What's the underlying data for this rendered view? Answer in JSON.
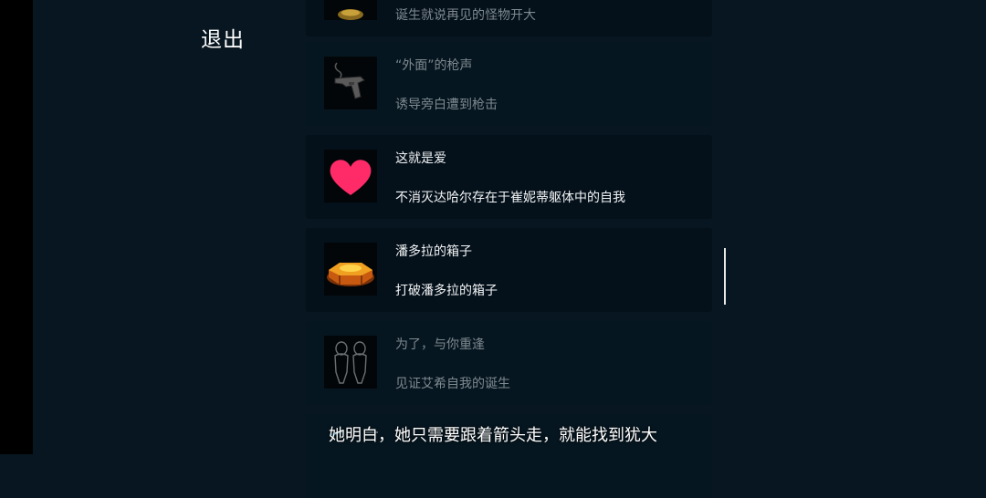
{
  "header": {
    "exit_label": "退出"
  },
  "achievements": [
    {
      "title": "",
      "description": "诞生就说再见的怪物开大",
      "icon": "gold-item-icon",
      "unlocked": false
    },
    {
      "title": "“外面”的枪声",
      "description": "诱导旁白遭到枪击",
      "icon": "pistol-icon",
      "unlocked": false
    },
    {
      "title": "这就是爱",
      "description": "不消灭达哈尔存在于崔妮蒂躯体中的自我",
      "icon": "heart-icon",
      "unlocked": true
    },
    {
      "title": "潘多拉的箱子",
      "description": "打破潘多拉的箱子",
      "icon": "pandora-box-icon",
      "unlocked": true
    },
    {
      "title": "为了，与你重逢",
      "description": "见证艾希自我的诞生",
      "icon": "twin-figures-icon",
      "unlocked": false
    }
  ],
  "subtitle": "她明白，她只需要跟着箭头走，就能找到犹大",
  "colors": {
    "background": "#071620",
    "card": "#04101a",
    "heart": "#ff2a68",
    "box": "#e07a1a"
  }
}
